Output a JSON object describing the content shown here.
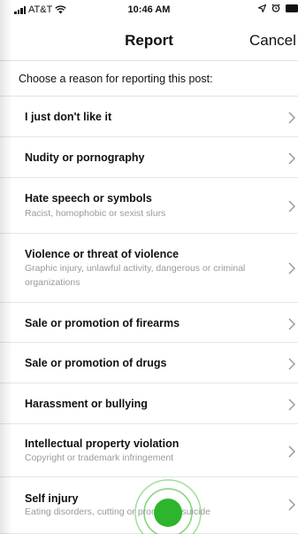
{
  "status_bar": {
    "carrier": "AT&T",
    "time": "10:46 AM"
  },
  "nav": {
    "title": "Report",
    "cancel_label": "Cancel"
  },
  "prompt": "Choose a reason for reporting this post:",
  "reasons": [
    {
      "title": "I just don't like it",
      "subtitle": ""
    },
    {
      "title": "Nudity or pornography",
      "subtitle": ""
    },
    {
      "title": "Hate speech or symbols",
      "subtitle": "Racist, homophobic or sexist slurs"
    },
    {
      "title": "Violence or threat of violence",
      "subtitle": "Graphic injury, unlawful activity, dangerous or criminal organizations"
    },
    {
      "title": "Sale or promotion of firearms",
      "subtitle": ""
    },
    {
      "title": "Sale or promotion of drugs",
      "subtitle": ""
    },
    {
      "title": "Harassment or bullying",
      "subtitle": ""
    },
    {
      "title": "Intellectual property violation",
      "subtitle": "Copyright or trademark infringement"
    },
    {
      "title": "Self injury",
      "subtitle": "Eating disorders, cutting or promoting suicide"
    }
  ],
  "colors": {
    "tap_indicator": "#2db52d"
  },
  "icons": {
    "row_chevron": "chevron-right-icon",
    "location": "location-arrow-icon",
    "alarm": "alarm-icon",
    "battery": "battery-icon",
    "wifi": "wifi-icon",
    "signal": "signal-bars-icon"
  }
}
